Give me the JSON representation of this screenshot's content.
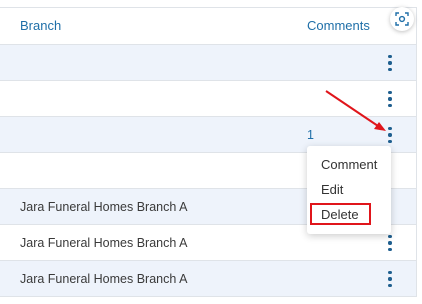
{
  "table": {
    "headers": {
      "branch": "Branch",
      "comments": "Comments"
    },
    "rows": [
      {
        "branch": "",
        "comments": ""
      },
      {
        "branch": "",
        "comments": ""
      },
      {
        "branch": "",
        "comments": "1"
      },
      {
        "branch": "",
        "comments": ""
      },
      {
        "branch": "Jara Funeral Homes Branch A",
        "comments": ""
      },
      {
        "branch": "Jara Funeral Homes Branch A",
        "comments": ""
      },
      {
        "branch": "Jara Funeral Homes Branch A",
        "comments": ""
      }
    ]
  },
  "row_menu": {
    "items": [
      "Comment",
      "Edit",
      "Delete"
    ]
  },
  "icons": {
    "row_actions": "kebab-vertical-icon",
    "column_settings": "focus-settings-icon"
  },
  "colors": {
    "link": "#1f6fa8",
    "row_alt": "#eef3fb",
    "highlight": "#e0151b"
  }
}
